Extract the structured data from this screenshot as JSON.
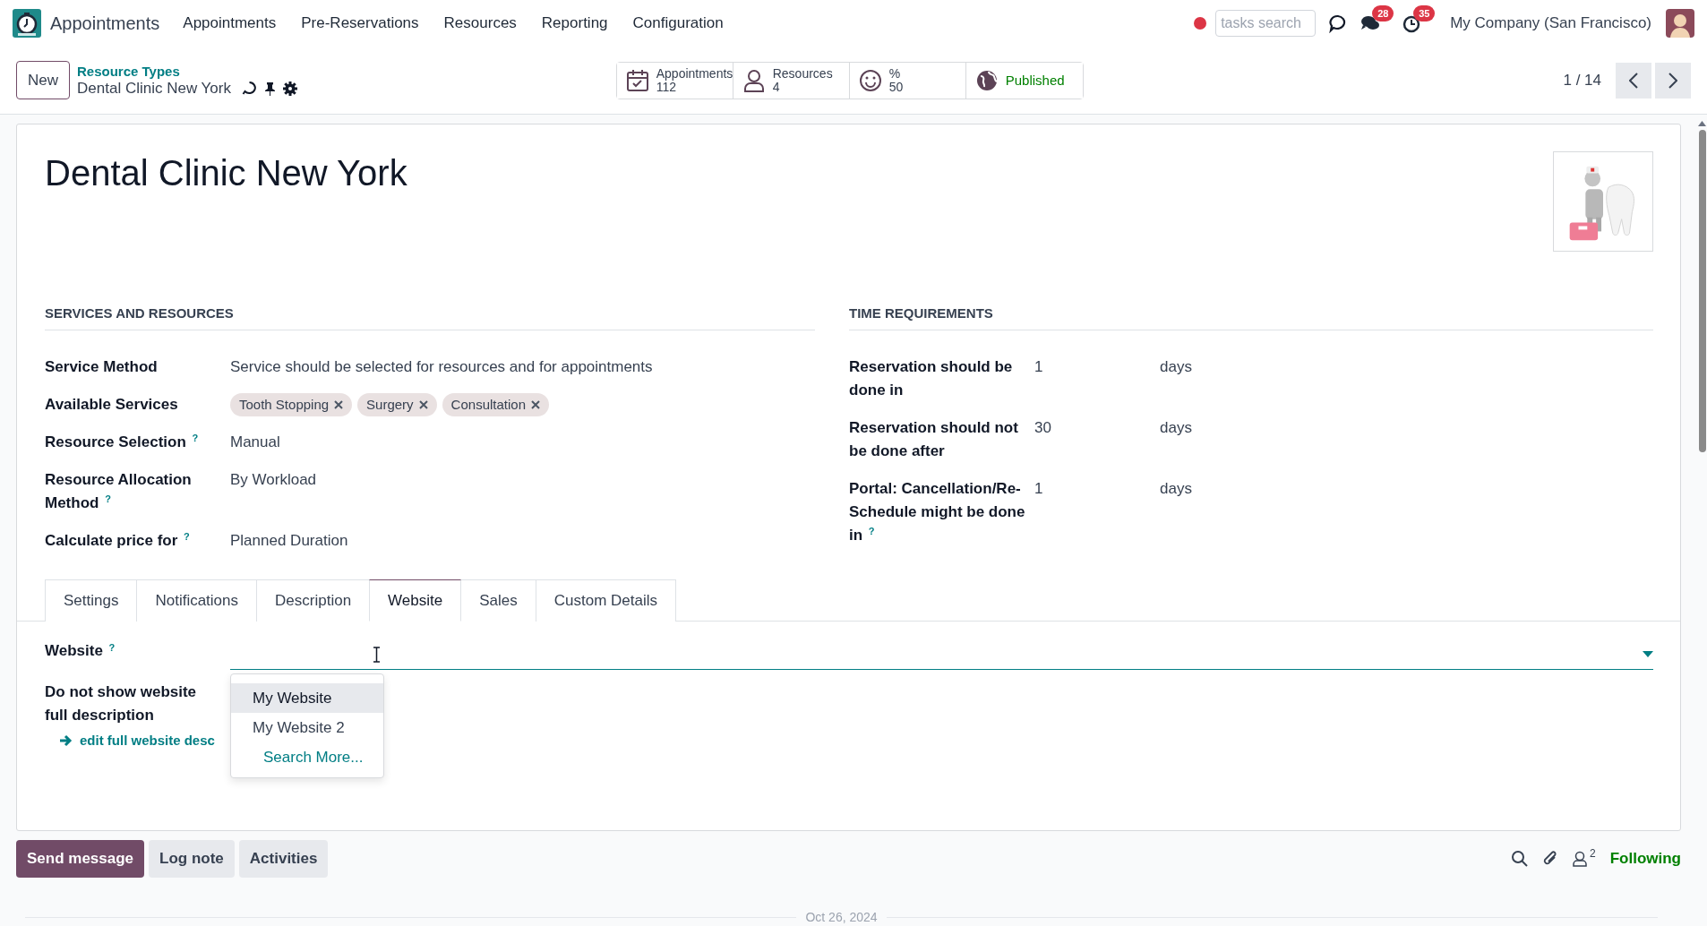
{
  "app": {
    "name": "Appointments"
  },
  "menu": [
    "Appointments",
    "Pre-Reservations",
    "Resources",
    "Reporting",
    "Configuration"
  ],
  "systray": {
    "search_placeholder": "tasks search",
    "messages_badge": "28",
    "activities_badge": "35",
    "company": "My Company (San Francisco)"
  },
  "control_panel": {
    "new_button": "New",
    "breadcrumb": "Resource Types",
    "record": "Dental Clinic New York",
    "stats": [
      {
        "kind": "calendar",
        "label": "Appointments",
        "value": "112"
      },
      {
        "kind": "person",
        "label": "Resources",
        "value": "4"
      },
      {
        "kind": "smiley",
        "label": "%",
        "value": "50"
      },
      {
        "kind": "globe",
        "label": "Published"
      }
    ],
    "pager": "1 / 14"
  },
  "form": {
    "title": "Dental Clinic New York",
    "sections": [
      {
        "title": "SERVICES AND RESOURCES",
        "fields": [
          {
            "label": "Service Method",
            "kind": "text",
            "value": "Service should be selected for resources and for appointments"
          },
          {
            "label": "Available Services",
            "kind": "tags",
            "tags": [
              "Tooth Stopping",
              "Surgery",
              "Consultation"
            ]
          },
          {
            "label": "Resource Selection $^{?}$",
            "kind": "text",
            "value": "Manual"
          },
          {
            "label": "Resource Allocation Method $^{?}$",
            "kind": "text",
            "value": "By Workload"
          },
          {
            "label": "Calculate price for $^{?}$",
            "kind": "text",
            "value": "Planned Duration"
          }
        ]
      },
      {
        "title": "TIME REQUIREMENTS",
        "fields": [
          {
            "label": "Reservation should be done in",
            "kind": "duration",
            "value": "1",
            "unit": "days"
          },
          {
            "label": "Reservation should not be done after",
            "kind": "duration",
            "value": "30",
            "unit": "days"
          },
          {
            "label": "Portal: Cancellation/Re-Schedule might be done in $^{?}$",
            "kind": "duration",
            "value": "1",
            "unit": "days"
          }
        ]
      }
    ],
    "tabs": [
      {
        "label": "Settings",
        "selected": false
      },
      {
        "label": "Notifications",
        "selected": false
      },
      {
        "label": "Description",
        "selected": false
      },
      {
        "label": "Website",
        "selected": true
      },
      {
        "label": "Sales",
        "selected": false
      },
      {
        "label": "Custom Details",
        "selected": false
      }
    ],
    "website_tab": {
      "website_field": {
        "label": "Website $^{?}$"
      },
      "description_toggle": {
        "label": "Do not show website full description"
      },
      "edit_link": "edit full website desc",
      "dropdown": [
        {
          "label": "My Website",
          "kind": "option",
          "selected": true
        },
        {
          "label": "My Website 2",
          "kind": "option",
          "selected": false
        },
        {
          "label": "Search More...",
          "kind": "action",
          "selected": false
        }
      ]
    }
  },
  "chatter": {
    "buttons": [
      {
        "label": "Send message",
        "primary": true
      },
      {
        "label": "Log note",
        "primary": false
      },
      {
        "label": "Activities",
        "primary": false
      }
    ],
    "followers_count": "2",
    "follow_label": "Following",
    "date": "Oct 26, 2024"
  }
}
